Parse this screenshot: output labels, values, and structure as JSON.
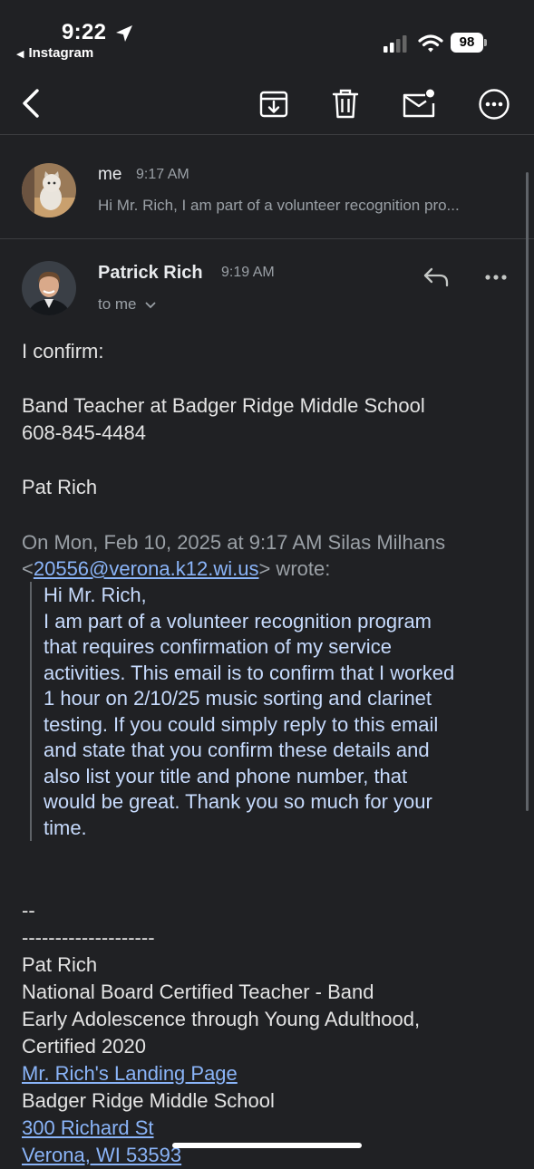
{
  "status_bar": {
    "time": "9:22",
    "back_app": "Instagram",
    "battery": "98"
  },
  "toolbar": {
    "icons": [
      "back-icon",
      "archive-icon",
      "trash-icon",
      "mark-unread-icon",
      "more-icon"
    ]
  },
  "messages": [
    {
      "sender": "me",
      "time": "9:17 AM",
      "snippet": "Hi Mr. Rich, I am part of a volunteer recognition pro..."
    },
    {
      "sender": "Patrick Rich",
      "time": "9:19 AM",
      "to_line": "to me",
      "body_line1": "I confirm:",
      "body_line2": "Band Teacher at Badger Ridge Middle School",
      "body_line3": "608-845-4484",
      "body_line4": "Pat Rich",
      "quote_header_pre": "On Mon, Feb 10, 2025 at 9:17 AM Silas Milhans",
      "quote_header_lt": "<",
      "quote_header_email": "20556@verona.k12.wi.us",
      "quote_header_post": "> wrote:",
      "quote_lines": [
        "Hi Mr. Rich,",
        "I am part of a volunteer recognition program",
        "that requires confirmation of my service",
        "activities. This email is to confirm that I worked",
        "1 hour on 2/10/25 music sorting and clarinet",
        "testing. If you could simply reply to this email",
        "and state that you confirm these details and",
        "also list your title and phone number, that",
        "would be great. Thank you so much for your",
        "time."
      ],
      "signature": {
        "sep1": "--",
        "sep2": "--------------------",
        "name": "Pat Rich",
        "title": "National Board Certified Teacher - Band",
        "cert1": "Early Adolescence through Young Adulthood,",
        "cert2": "Certified 2020",
        "link_landing": "Mr. Rich's Landing Page",
        "school": "Badger Ridge Middle School",
        "address1": "300 Richard St",
        "address2": "Verona, WI 53593"
      }
    }
  ]
}
